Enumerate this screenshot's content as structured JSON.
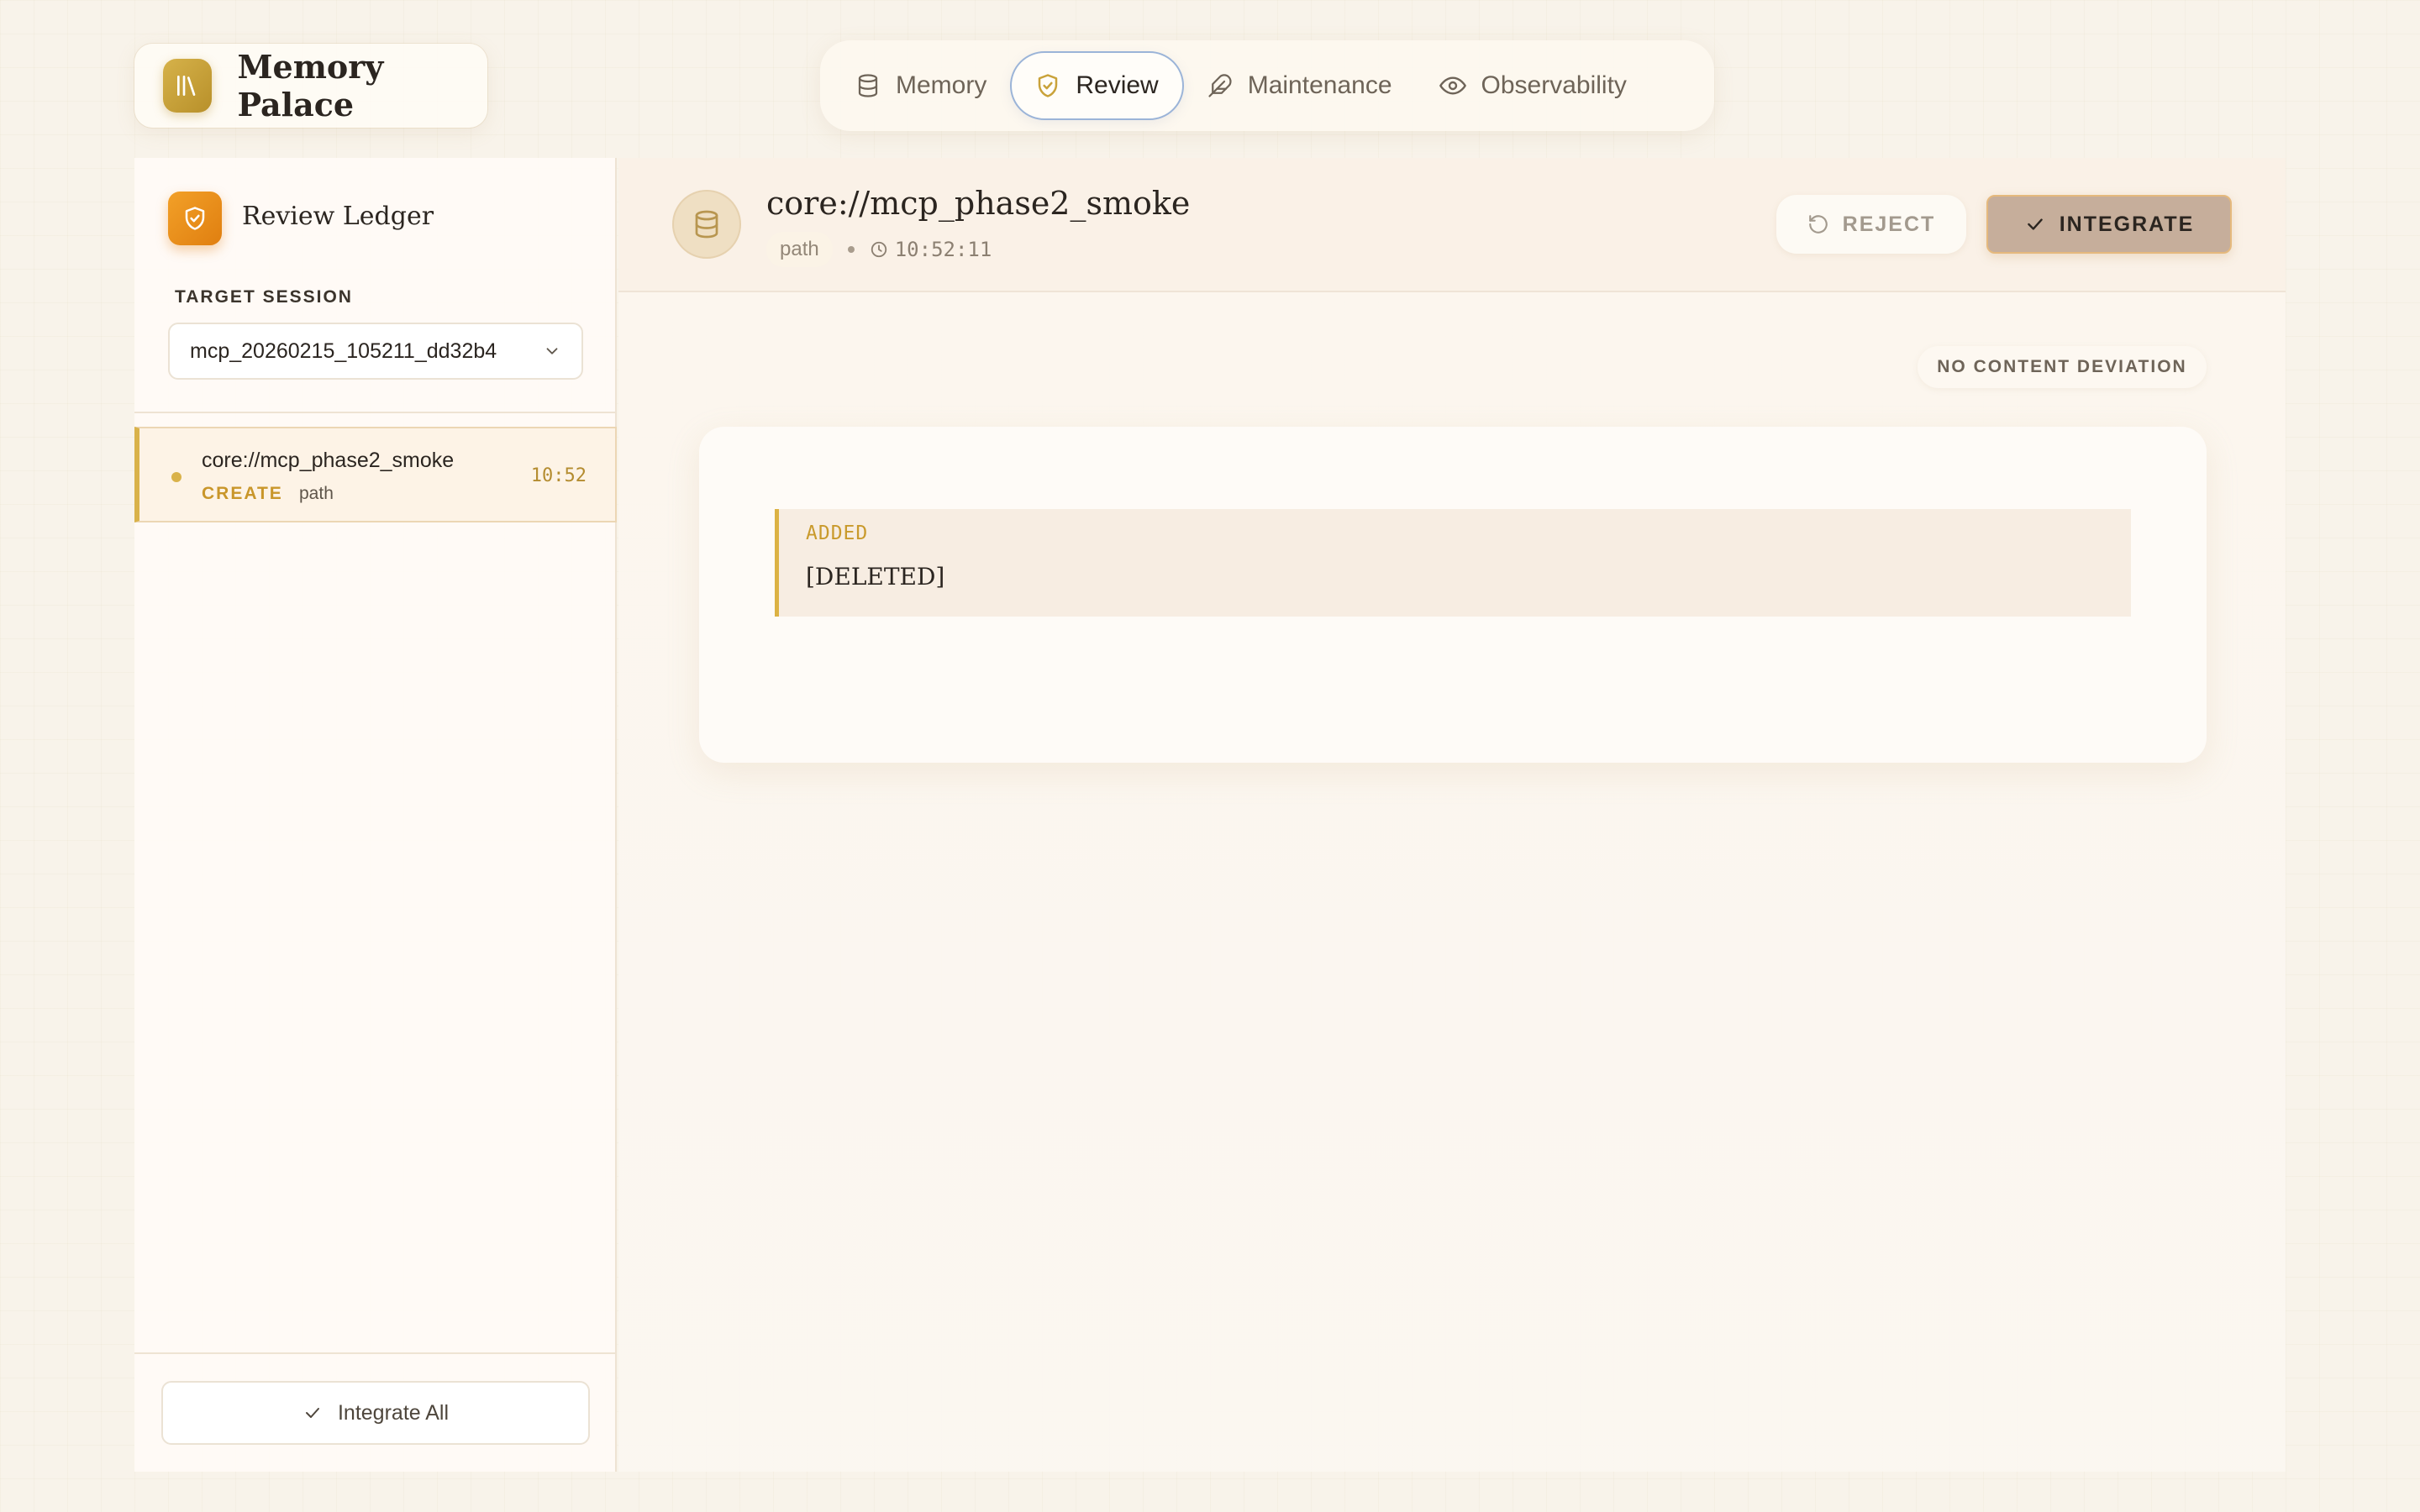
{
  "brand": {
    "title": "Memory Palace",
    "logo_icon": "library-icon",
    "accent": "#c9a23a"
  },
  "nav": {
    "tabs": [
      {
        "label": "Memory",
        "icon": "database-icon",
        "active": false
      },
      {
        "label": "Review",
        "icon": "shield-check-icon",
        "active": true
      },
      {
        "label": "Maintenance",
        "icon": "feather-icon",
        "active": false
      },
      {
        "label": "Observability",
        "icon": "eye-icon",
        "active": false
      }
    ]
  },
  "sidebar": {
    "title": "Review Ledger",
    "target_session_label": "TARGET SESSION",
    "session_value": "mcp_20260215_105211_dd32b4",
    "items": [
      {
        "title": "core://mcp_phase2_smoke",
        "action": "CREATE",
        "kind": "path",
        "time": "10:52"
      }
    ],
    "integrate_all_label": "Integrate All"
  },
  "main": {
    "title": "core://mcp_phase2_smoke",
    "kind": "path",
    "timestamp": "10:52:11",
    "reject_label": "REJECT",
    "integrate_label": "INTEGRATE",
    "deviation_badge": "NO CONTENT DEVIATION",
    "diff": {
      "label": "ADDED",
      "content": "[DELETED]"
    }
  },
  "colors": {
    "background": "#f8f3ea",
    "accent_gold": "#d9b24a",
    "accent_orange": "#e88f18",
    "active_tab_border": "#9bb4d8",
    "integrate_button": "#c6ae9b"
  }
}
